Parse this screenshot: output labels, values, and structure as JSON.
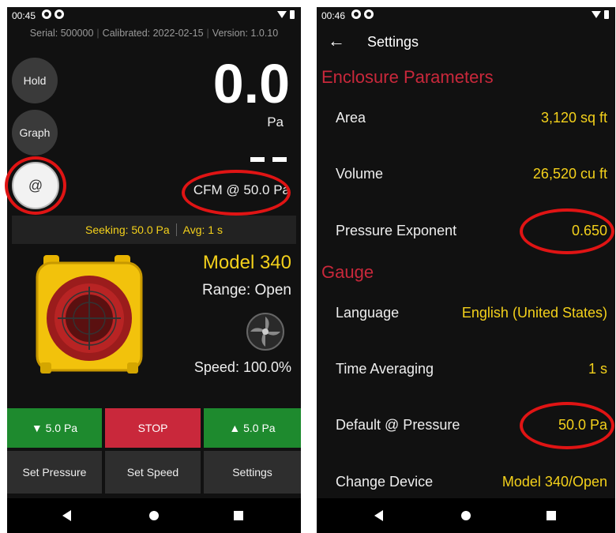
{
  "left": {
    "status": {
      "time": "00:45"
    },
    "info": {
      "serial": "Serial: 500000",
      "calibrated": "Calibrated: 2022-02-15",
      "version": "Version: 1.0.10"
    },
    "buttons": {
      "hold": "Hold",
      "graph": "Graph",
      "at": "@"
    },
    "reading": {
      "value": "0.0",
      "unit": "Pa",
      "flow_label": "CFM @ 50.0 Pa"
    },
    "seek": {
      "seeking": "Seeking: 50.0 Pa",
      "avg": "Avg: 1 s"
    },
    "device": {
      "model": "Model 340",
      "range": "Range: Open",
      "speed": "Speed: 100.0%"
    },
    "controls": {
      "down": "▼ 5.0 Pa",
      "stop": "STOP",
      "up": "▲ 5.0 Pa",
      "set_pressure": "Set Pressure",
      "set_speed": "Set Speed",
      "settings": "Settings"
    }
  },
  "right": {
    "status": {
      "time": "00:46"
    },
    "title": "Settings",
    "sections": {
      "enclosure": "Enclosure Parameters",
      "gauge": "Gauge"
    },
    "rows": {
      "area": {
        "label": "Area",
        "value": "3,120 sq ft"
      },
      "volume": {
        "label": "Volume",
        "value": "26,520 cu ft"
      },
      "exponent": {
        "label": "Pressure Exponent",
        "value": "0.650"
      },
      "language": {
        "label": "Language",
        "value": "English (United States)"
      },
      "time_avg": {
        "label": "Time Averaging",
        "value": "1 s"
      },
      "default_pressure": {
        "label": "Default @ Pressure",
        "value": "50.0 Pa"
      },
      "device": {
        "label": "Change Device",
        "value": "Model 340/Open"
      }
    }
  },
  "colors": {
    "accent_yellow": "#f4d11b",
    "stop_red": "#c9283b",
    "go_green": "#1e8a2e",
    "highlight": "#e01414"
  }
}
